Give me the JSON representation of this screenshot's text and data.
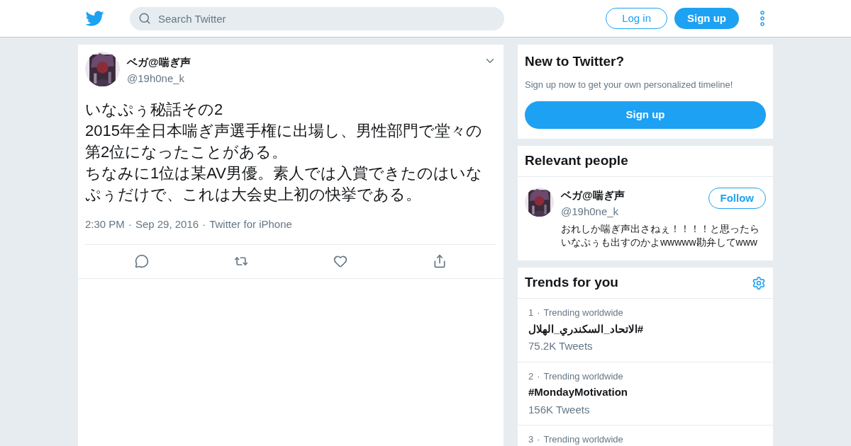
{
  "header": {
    "search": {
      "placeholder": "Search Twitter"
    },
    "login": "Log in",
    "signup": "Sign up"
  },
  "tweet": {
    "name": "ベガ@喘ぎ声",
    "handle": "@19h0ne_k",
    "text_lines": [
      "いなぷぅ秘話その2",
      "2015年全日本喘ぎ声選手権に出場し、男性部門で堂々の第2位になったことがある。",
      "ちなみに1位は某AV男優。素人では入賞できたのはいなぷぅだけで、これは大会史上初の快挙である。"
    ],
    "meta": [
      "2:30 PM",
      "Sep 29, 2016",
      "Twitter for iPhone"
    ],
    "separator": "·"
  },
  "signup_card": {
    "title": "New to Twitter?",
    "subtitle": "Sign up now to get your own personalized timeline!",
    "button": "Sign up"
  },
  "relevant_people": {
    "title": "Relevant people",
    "people": [
      {
        "name": "ベガ@喘ぎ声",
        "handle": "@19h0ne_k",
        "bio": "おれしか喘ぎ声出さねぇ！！！！と思ったらいなぷぅも出すのかよwwwww勘弁してwww",
        "follow": "Follow"
      }
    ]
  },
  "trends": {
    "title": "Trends for you",
    "separator": "·",
    "items": [
      {
        "rank": "1",
        "context": "Trending worldwide",
        "name": "#الاتحاد_السكندري_الهلال",
        "count": "75.2K Tweets"
      },
      {
        "rank": "2",
        "context": "Trending worldwide",
        "name": "#MondayMotivation",
        "count": "156K Tweets"
      },
      {
        "rank": "3",
        "context": "Trending worldwide"
      }
    ]
  }
}
